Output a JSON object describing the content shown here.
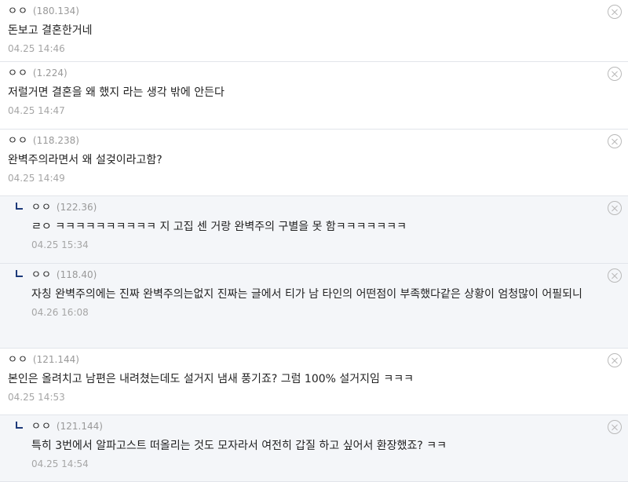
{
  "comments": [
    {
      "nick": "ㅇㅇ",
      "ip": "(180.134)",
      "text": "돈보고 결혼한거네",
      "date": "04.25 14:46",
      "reply": false
    },
    {
      "nick": "ㅇㅇ",
      "ip": "(1.224)",
      "text": "저럴거면 결혼을 왜 했지 라는 생각 밖에 안든다",
      "date": "04.25 14:47",
      "reply": false
    },
    {
      "nick": "ㅇㅇ",
      "ip": "(118.238)",
      "text": "완벽주의라면서 왜 설겆이라고함?",
      "date": "04.25 14:49",
      "reply": false
    },
    {
      "nick": "ㅇㅇ",
      "ip": "(122.36)",
      "text": "ㄹㅇ ㅋㅋㅋㅋㅋㅋㅋㅋㅋㅋ 지 고집 센 거랑 완벽주의 구별을 못 함ㅋㅋㅋㅋㅋㅋㅋ",
      "date": "04.25 15:34",
      "reply": true
    },
    {
      "nick": "ㅇㅇ",
      "ip": "(118.40)",
      "text": "자칭 완벽주의에는 진짜 완벽주의는없지 진짜는 글에서 티가 남 타인의 어떤점이 부족했다같은 상황이 엄청많이 어필되니",
      "date": "04.26 16:08",
      "reply": true
    },
    {
      "nick": "ㅇㅇ",
      "ip": "(121.144)",
      "text": "본인은 올려치고 남편은 내려쳤는데도 설거지 냄새 풍기죠? 그럼 100% 설거지임 ㅋㅋㅋ",
      "date": "04.25 14:53",
      "reply": false
    },
    {
      "nick": "ㅇㅇ",
      "ip": "(121.144)",
      "text": "특히 3번에서 알파고스트 떠올리는 것도 모자라서 여전히 갑질 하고 싶어서 환장했죠? ㅋㅋ",
      "date": "04.25 14:54",
      "reply": true
    }
  ]
}
